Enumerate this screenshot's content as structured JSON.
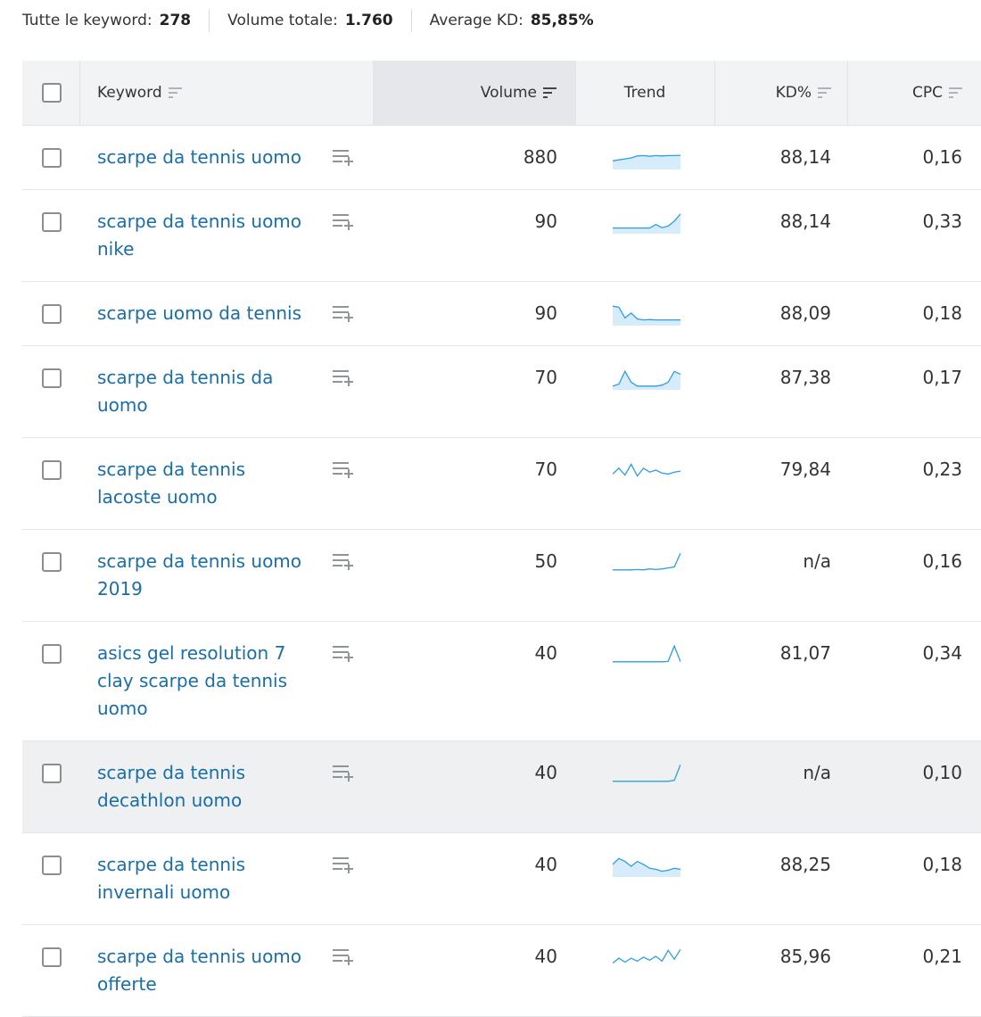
{
  "summary": {
    "all_keywords_label": "Tutte le keyword:",
    "all_keywords_value": "278",
    "total_volume_label": "Volume totale:",
    "total_volume_value": "1.760",
    "avg_kd_label": "Average KD:",
    "avg_kd_value": "85,85%"
  },
  "columns": {
    "keyword": "Keyword",
    "volume": "Volume",
    "trend": "Trend",
    "kd": "KD%",
    "cpc": "CPC"
  },
  "colors": {
    "link": "#1a6ea8",
    "trend_line": "#2e9ee0",
    "trend_fill": "#d6ecfa",
    "highlight_row": "#eef0f2"
  },
  "rows": [
    {
      "keyword_lines": [
        "scarpe da tennis uomo"
      ],
      "volume": "880",
      "kd": "88,14",
      "cpc": "0,16",
      "trend": [
        0.35,
        0.4,
        0.45,
        0.5,
        0.6,
        0.62,
        0.58,
        0.62,
        0.6,
        0.62,
        0.62,
        0.63
      ],
      "trend_fill": true
    },
    {
      "keyword_lines": [
        "scarpe da tennis uomo",
        "nike"
      ],
      "volume": "90",
      "kd": "88,14",
      "cpc": "0,33",
      "trend": [
        0.2,
        0.2,
        0.2,
        0.2,
        0.2,
        0.2,
        0.2,
        0.38,
        0.22,
        0.3,
        0.55,
        0.92
      ],
      "trend_fill": true
    },
    {
      "keyword_lines": [
        "scarpe uomo da tennis"
      ],
      "volume": "90",
      "kd": "88,09",
      "cpc": "0,18",
      "trend": [
        0.9,
        0.85,
        0.3,
        0.55,
        0.25,
        0.2,
        0.22,
        0.2,
        0.2,
        0.2,
        0.2,
        0.2
      ],
      "trend_fill": true
    },
    {
      "keyword_lines": [
        "scarpe da tennis da",
        "uomo"
      ],
      "volume": "70",
      "kd": "87,38",
      "cpc": "0,17",
      "trend": [
        0.1,
        0.2,
        0.85,
        0.3,
        0.1,
        0.1,
        0.1,
        0.1,
        0.15,
        0.3,
        0.85,
        0.7
      ],
      "trend_fill": true
    },
    {
      "keyword_lines": [
        "scarpe da tennis",
        "lacoste uomo"
      ],
      "volume": "70",
      "kd": "79,84",
      "cpc": "0,23",
      "trend": [
        0.3,
        0.6,
        0.25,
        0.8,
        0.2,
        0.6,
        0.4,
        0.5,
        0.35,
        0.3,
        0.4,
        0.45
      ],
      "trend_fill": false
    },
    {
      "keyword_lines": [
        "scarpe da tennis uomo",
        "2019"
      ],
      "volume": "50",
      "kd": "n/a",
      "cpc": "0,16",
      "trend": [
        0.1,
        0.1,
        0.1,
        0.1,
        0.12,
        0.1,
        0.15,
        0.12,
        0.15,
        0.2,
        0.25,
        0.95
      ],
      "trend_fill": false
    },
    {
      "keyword_lines": [
        "asics gel resolution 7",
        "clay scarpe da tennis",
        "uomo"
      ],
      "volume": "40",
      "kd": "81,07",
      "cpc": "0,34",
      "trend": [
        0.1,
        0.1,
        0.1,
        0.1,
        0.1,
        0.1,
        0.1,
        0.1,
        0.1,
        0.12,
        0.9,
        0.1
      ],
      "trend_fill": false
    },
    {
      "keyword_lines": [
        "scarpe da tennis",
        "decathlon uomo"
      ],
      "volume": "40",
      "kd": "n/a",
      "cpc": "0,10",
      "trend": [
        0.1,
        0.1,
        0.1,
        0.1,
        0.1,
        0.1,
        0.1,
        0.1,
        0.1,
        0.1,
        0.15,
        0.95
      ],
      "trend_fill": false,
      "highlighted": true
    },
    {
      "keyword_lines": [
        "scarpe da tennis",
        "invernali uomo"
      ],
      "volume": "40",
      "kd": "88,25",
      "cpc": "0,18",
      "trend": [
        0.55,
        0.85,
        0.7,
        0.45,
        0.7,
        0.55,
        0.35,
        0.3,
        0.2,
        0.25,
        0.35,
        0.3
      ],
      "trend_fill": true
    },
    {
      "keyword_lines": [
        "scarpe da tennis uomo",
        "offerte"
      ],
      "volume": "40",
      "kd": "85,96",
      "cpc": "0,21",
      "trend": [
        0.2,
        0.45,
        0.25,
        0.45,
        0.3,
        0.5,
        0.35,
        0.55,
        0.3,
        0.85,
        0.4,
        0.9
      ],
      "trend_fill": false
    }
  ]
}
